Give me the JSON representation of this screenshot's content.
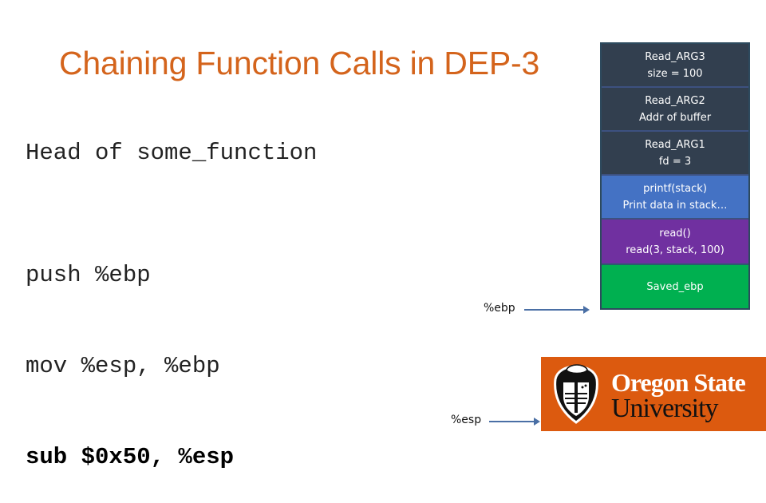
{
  "slide": {
    "title": "Chaining Function Calls in DEP-3",
    "code_heading": "Head of some_function",
    "code_lines": [
      {
        "text": "push %ebp",
        "bold": false
      },
      {
        "text": "mov %esp, %ebp",
        "bold": false
      },
      {
        "text": "sub $0x50, %esp",
        "bold": true
      }
    ]
  },
  "stack": {
    "cells": [
      {
        "line1": "Read_ARG3",
        "line2": "size = 100",
        "color": "#323f4f"
      },
      {
        "line1": "Read_ARG2",
        "line2": "Addr of buffer",
        "color": "#323f4f"
      },
      {
        "line1": "Read_ARG1",
        "line2": "fd = 3",
        "color": "#323f4f"
      },
      {
        "line1": "printf(stack)",
        "line2": "Print data in stack…",
        "color": "#4472c4"
      },
      {
        "line1": "read()",
        "line2": "read(3, stack, 100)",
        "color": "#7030a0"
      },
      {
        "line1": "Saved_ebp",
        "line2": "",
        "color": "#00b050"
      }
    ]
  },
  "registers": {
    "ebp_label": "%ebp",
    "esp_label": "%esp"
  },
  "logo": {
    "line1": "Oregon State",
    "line2": "University",
    "bg_color": "#dc5a0f"
  }
}
